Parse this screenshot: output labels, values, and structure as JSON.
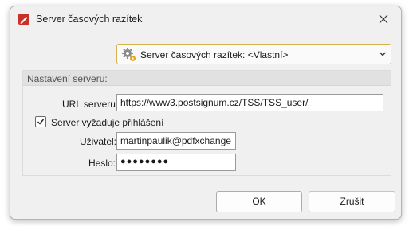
{
  "window": {
    "title": "Server časových razítek",
    "close_icon": "close-icon"
  },
  "profile": {
    "selected": "Server časových razítek: <Vlastní>",
    "icon": "gear-icon"
  },
  "group": {
    "title": "Nastavení serveru:",
    "url_label": "URL serveru:",
    "url_value": "https://www3.postsignum.cz/TSS/TSS_user/",
    "auth_checkbox_label": "Server vyžaduje přihlášení",
    "auth_checked": true,
    "user_label": "Uživatel:",
    "user_value": "martinpaulik@pdfxchange",
    "password_label": "Heslo:",
    "password_value": "●●●●●●●●"
  },
  "buttons": {
    "ok": "OK",
    "cancel": "Zrušit"
  },
  "colors": {
    "accent_border": "#d4b24c",
    "app_icon": "#c8302a",
    "dialog_bg": "#f0f0f0"
  }
}
